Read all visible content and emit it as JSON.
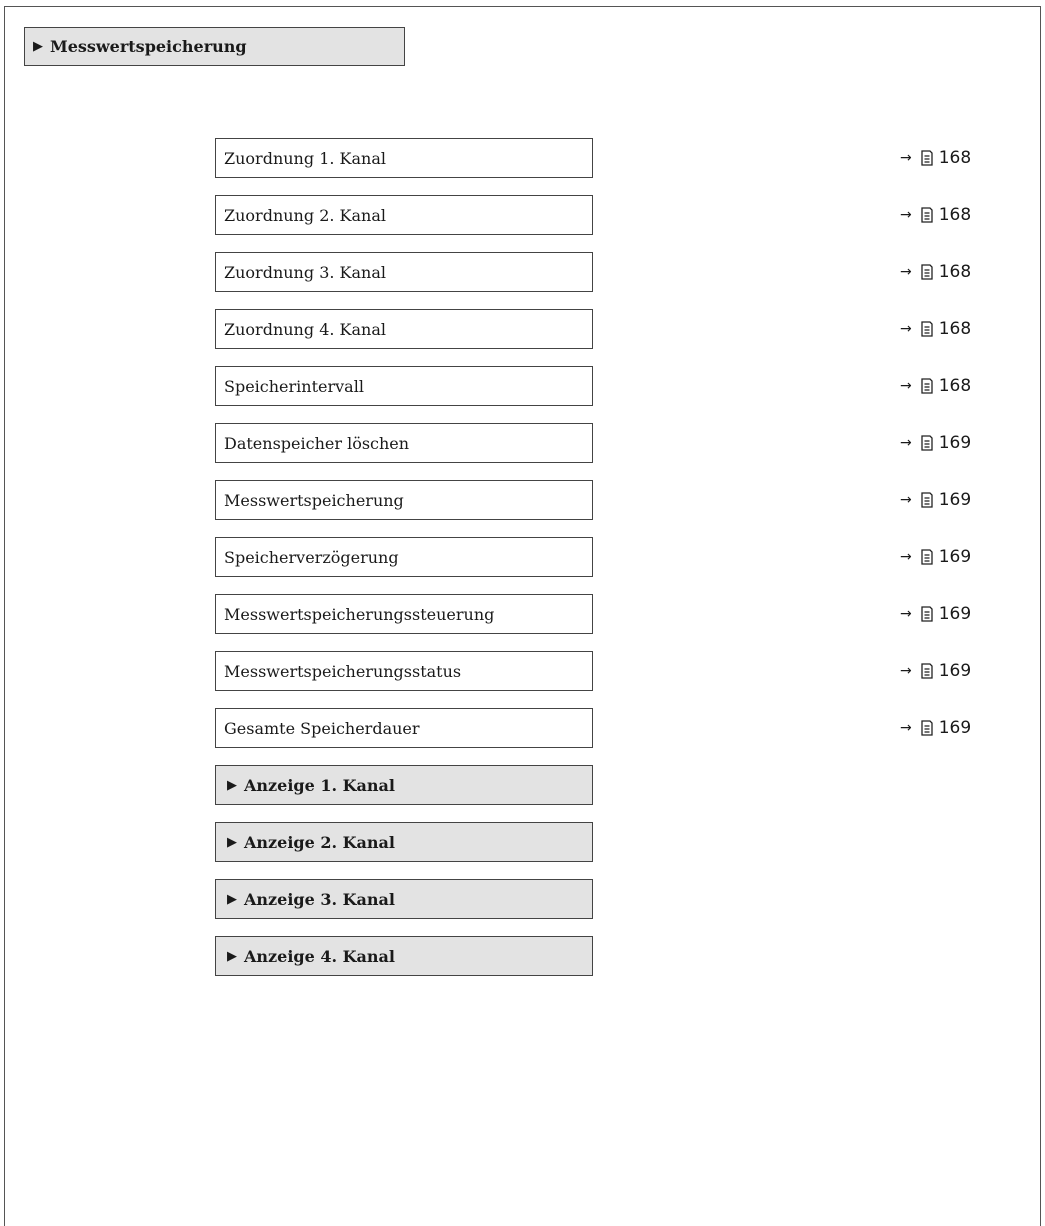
{
  "header": {
    "title": "Messwertspeicherung"
  },
  "parameters": [
    {
      "label": "Zuordnung 1. Kanal",
      "page": "168"
    },
    {
      "label": "Zuordnung 2. Kanal",
      "page": "168"
    },
    {
      "label": "Zuordnung 3. Kanal",
      "page": "168"
    },
    {
      "label": "Zuordnung 4. Kanal",
      "page": "168"
    },
    {
      "label": "Speicherintervall",
      "page": "168"
    },
    {
      "label": "Datenspeicher löschen",
      "page": "169"
    },
    {
      "label": "Messwertspeicherung",
      "page": "169"
    },
    {
      "label": "Speicherverzögerung",
      "page": "169"
    },
    {
      "label": "Messwertspeicherungssteuerung",
      "page": "169"
    },
    {
      "label": "Messwertspeicherungsstatus",
      "page": "169"
    },
    {
      "label": "Gesamte Speicherdauer",
      "page": "169"
    }
  ],
  "submenus": [
    {
      "label": "Anzeige 1. Kanal"
    },
    {
      "label": "Anzeige 2. Kanal"
    },
    {
      "label": "Anzeige 3. Kanal"
    },
    {
      "label": "Anzeige 4. Kanal"
    }
  ],
  "icons": {
    "submenu_marker": "triangle-right-icon",
    "ref_arrow": "arrow-right-icon",
    "ref_page": "book-icon"
  }
}
